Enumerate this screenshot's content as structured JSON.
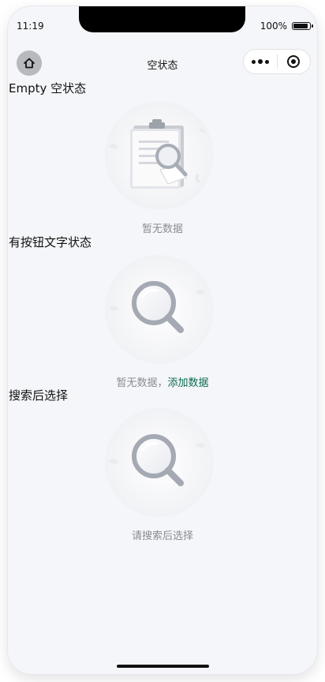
{
  "status_bar": {
    "time": "11:19",
    "battery_percent": "100%"
  },
  "navbar": {
    "title": "空状态",
    "home_icon": "home-icon",
    "more_icon": "more-dots-icon",
    "close_icon": "target-circle-icon"
  },
  "sections": [
    {
      "title": "Empty 空状态",
      "illustration": "clipboard-search-icon",
      "description": "暂无数据"
    },
    {
      "title": "有按钮文字状态",
      "illustration": "magnifier-icon",
      "description": "暂无数据，",
      "link_text": "添加数据"
    },
    {
      "title": "搜索后选择",
      "illustration": "magnifier-icon",
      "description": "请搜索后选择"
    }
  ],
  "colors": {
    "page_background": "#f5f6f9",
    "link": "#0b6b4f",
    "description_text": "#8a8c92"
  }
}
